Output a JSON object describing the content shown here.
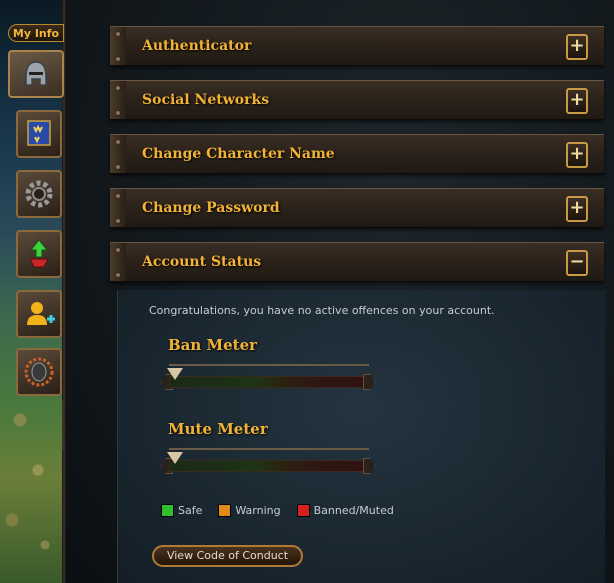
{
  "sidebar": {
    "my_info_label": "My Info",
    "buttons": [
      {
        "name": "helmet-icon"
      },
      {
        "name": "banner-icon"
      },
      {
        "name": "gear-icon"
      },
      {
        "name": "upgrade-gem-icon"
      },
      {
        "name": "add-user-icon"
      },
      {
        "name": "mouse-icon"
      }
    ]
  },
  "accordion": [
    {
      "title": "Authenticator",
      "toggle": "+"
    },
    {
      "title": "Social Networks",
      "toggle": "+"
    },
    {
      "title": "Change Character Name",
      "toggle": "+"
    },
    {
      "title": "Change Password",
      "toggle": "+"
    },
    {
      "title": "Account Status",
      "toggle": "−",
      "expanded": true
    }
  ],
  "account_status": {
    "message": "Congratulations, you have no active offences on your account.",
    "ban_meter": {
      "label": "Ban Meter",
      "level": 0
    },
    "mute_meter": {
      "label": "Mute Meter",
      "level": 0
    },
    "legend": [
      {
        "label": "Safe",
        "color": "#2fbf2f"
      },
      {
        "label": "Warning",
        "color": "#e08a1a"
      },
      {
        "label": "Banned/Muted",
        "color": "#d61f1f"
      }
    ],
    "conduct_button": "View Code of Conduct"
  },
  "colors": {
    "accent_gold": "#f2b335",
    "panel_bg": "#1a2730"
  }
}
